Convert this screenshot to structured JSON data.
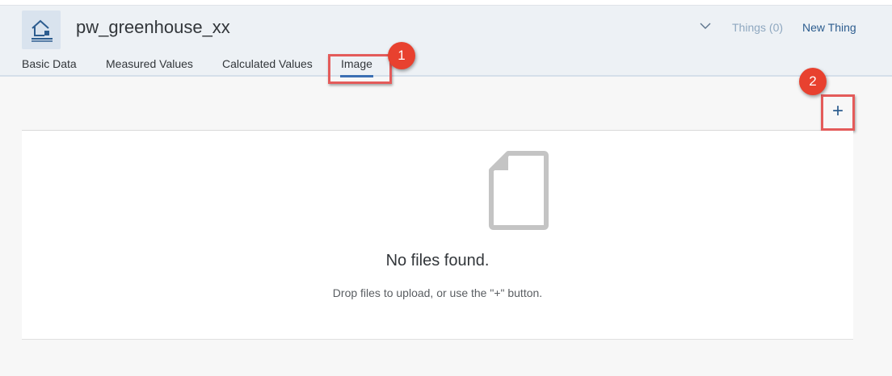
{
  "header": {
    "title": "pw_greenhouse_xx",
    "icon": "greenhouse-thing-icon",
    "things_label": "Things (0)",
    "new_thing_label": "New Thing"
  },
  "tabs": [
    {
      "label": "Basic Data"
    },
    {
      "label": "Measured Values"
    },
    {
      "label": "Calculated Values"
    },
    {
      "label": "Image",
      "selected": true
    }
  ],
  "callouts": [
    {
      "number": "1"
    },
    {
      "number": "2"
    }
  ],
  "toolbar": {
    "add_label": "+"
  },
  "empty_state": {
    "icon": "blank-file-icon",
    "title": "No files found.",
    "hint": "Drop files to upload, or use the \"+\" button."
  },
  "colors": {
    "accent": "#3b6fb3",
    "link": "#2d5d8f",
    "callout": "#e8412f",
    "header_bg": "#edf1f5"
  }
}
